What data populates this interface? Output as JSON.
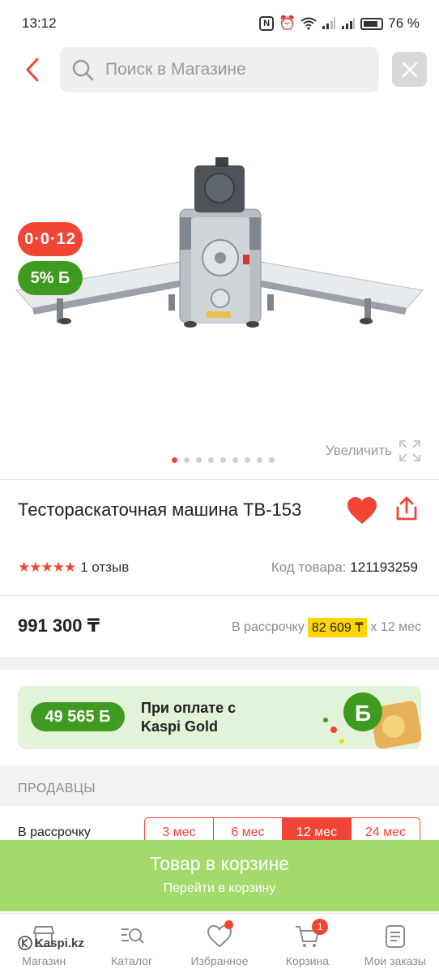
{
  "status_bar": {
    "time": "13:12",
    "battery": "76 %"
  },
  "search": {
    "placeholder": "Поиск в Магазине"
  },
  "gallery": {
    "installment_badge": "0·0·12",
    "bonus_badge": "5% Б",
    "zoom_label": "Увеличить",
    "image_count": 9,
    "active_image": 1
  },
  "product": {
    "title": "Тестораскаточная машина ТВ-153",
    "rating_stars": "★★★★★",
    "rating": 5,
    "reviews": "1 отзыв",
    "code_label": "Код товара:",
    "code_value": "121193259"
  },
  "price": {
    "value": "991 300 ₸",
    "installment_prefix": "В рассрочку",
    "installment_amount": "82 609 ₸",
    "installment_suffix": "х 12 мес"
  },
  "kaspi_gold": {
    "bonus": "49 565 Б",
    "text_line1": "При оплате с",
    "text_line2": "Kaspi Gold"
  },
  "sellers": {
    "section_title": "ПРОДАВЦЫ",
    "installment_label": "В рассрочку",
    "terms": [
      "3 мес",
      "6 мес",
      "12 мес",
      "24 мес"
    ],
    "active_term": "12 мес"
  },
  "cart_banner": {
    "title": "Товар в корзине",
    "subtitle": "Перейти в корзину"
  },
  "tabs": [
    {
      "label": "Магазин"
    },
    {
      "label": "Каталог"
    },
    {
      "label": "Избранное"
    },
    {
      "label": "Корзина",
      "badge": "1"
    },
    {
      "label": "Мои заказы"
    }
  ],
  "watermark": "Kaspi.kz",
  "colors": {
    "accent_red": "#f14635",
    "green": "#3f9b1f",
    "light_green": "#a4d96b",
    "yellow": "#ffd400"
  }
}
